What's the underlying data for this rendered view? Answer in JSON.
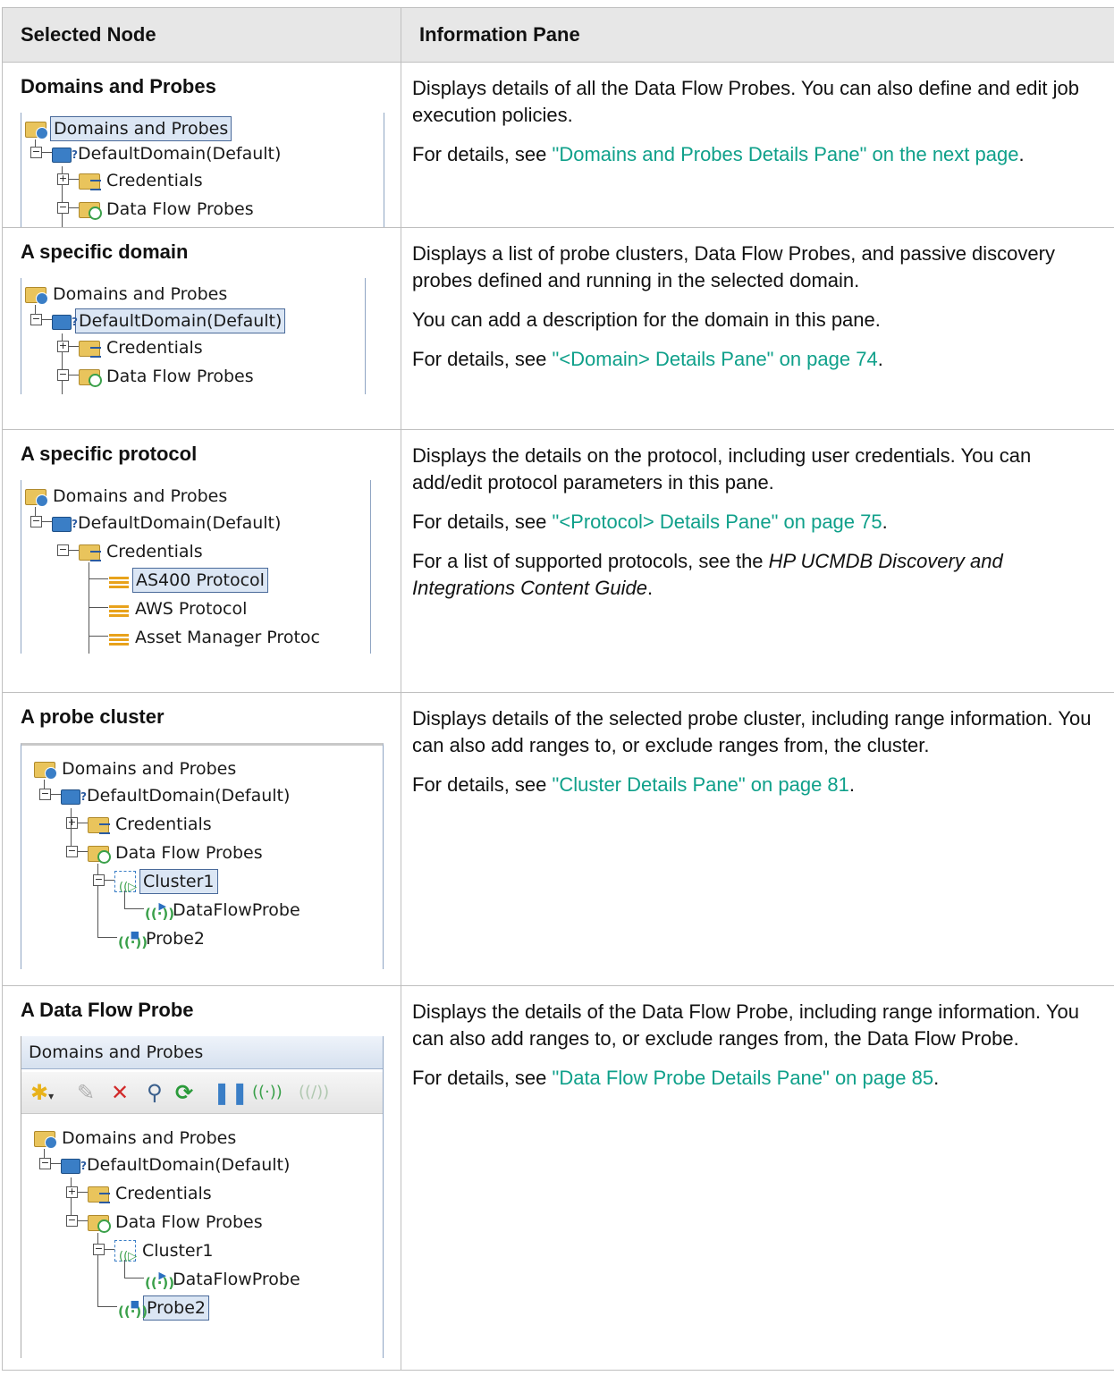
{
  "table": {
    "headers": [
      "Selected Node",
      "Information Pane"
    ],
    "rows": [
      {
        "node": "Domains and Probes",
        "desc": "Displays details of all the Data Flow Probes. You can also define and edit job execution policies.",
        "detail_prefix": "For details, see ",
        "detail_link": "\"Domains and Probes Details Pane\" on the next page",
        "detail_suffix": "."
      },
      {
        "node": "A specific domain",
        "desc": "Displays a list of probe clusters, Data Flow Probes, and passive discovery probes defined and running in the selected domain.",
        "desc2": "You can add a description for the domain in this pane.",
        "detail_prefix": "For details, see ",
        "detail_link": "\"<Domain> Details Pane\" on page 74",
        "detail_suffix": "."
      },
      {
        "node": "A specific protocol",
        "desc": "Displays the details on the protocol, including user credentials. You can add/edit protocol parameters in this pane.",
        "detail_prefix": "For details, see ",
        "detail_link": "\"<Protocol> Details Pane\" on page 75",
        "detail_suffix": ".",
        "extra_prefix": "For a list of supported protocols, see the ",
        "extra_italic": "HP UCMDB Discovery and Integrations Content Guide",
        "extra_suffix": "."
      },
      {
        "node": "A probe cluster",
        "desc": "Displays details of the selected probe cluster, including range information. You can also add ranges to, or exclude ranges from, the cluster.",
        "detail_prefix": "For details, see ",
        "detail_link": "\"Cluster Details Pane\" on page 81",
        "detail_suffix": "."
      },
      {
        "node": "A Data Flow Probe",
        "desc": "Displays the details of the Data Flow Probe, including range information. You can also add ranges to, or exclude ranges from, the Data Flow Probe.",
        "detail_prefix": "For details, see ",
        "detail_link": "\"Data Flow Probe Details Pane\" on page 85",
        "detail_suffix": "."
      }
    ]
  },
  "tree": {
    "root": "Domains and Probes",
    "domain": "DefaultDomain(Default)",
    "credentials": "Credentials",
    "probes_folder": "Data Flow Probes",
    "proto1": "AS400 Protocol",
    "proto2": "AWS Protocol",
    "proto3": "Asset Manager Protoc",
    "cluster": "Cluster1",
    "dfp": "DataFlowProbe",
    "probe2": "Probe2",
    "panel_title": "Domains and Probes"
  },
  "icons": [
    "folder-icon",
    "domain-icon",
    "credentials-folder-icon",
    "probes-folder-icon",
    "protocol-icon",
    "cluster-icon",
    "probe-icon",
    "new-icon",
    "edit-icon",
    "delete-icon",
    "search-icon",
    "refresh-icon",
    "pause-icon",
    "activate-probe-icon",
    "deactivate-probe-icon"
  ],
  "colors": {
    "link": "#0fa08a",
    "header_bg": "#e7e7e7",
    "selection": "#dbe6f4"
  }
}
